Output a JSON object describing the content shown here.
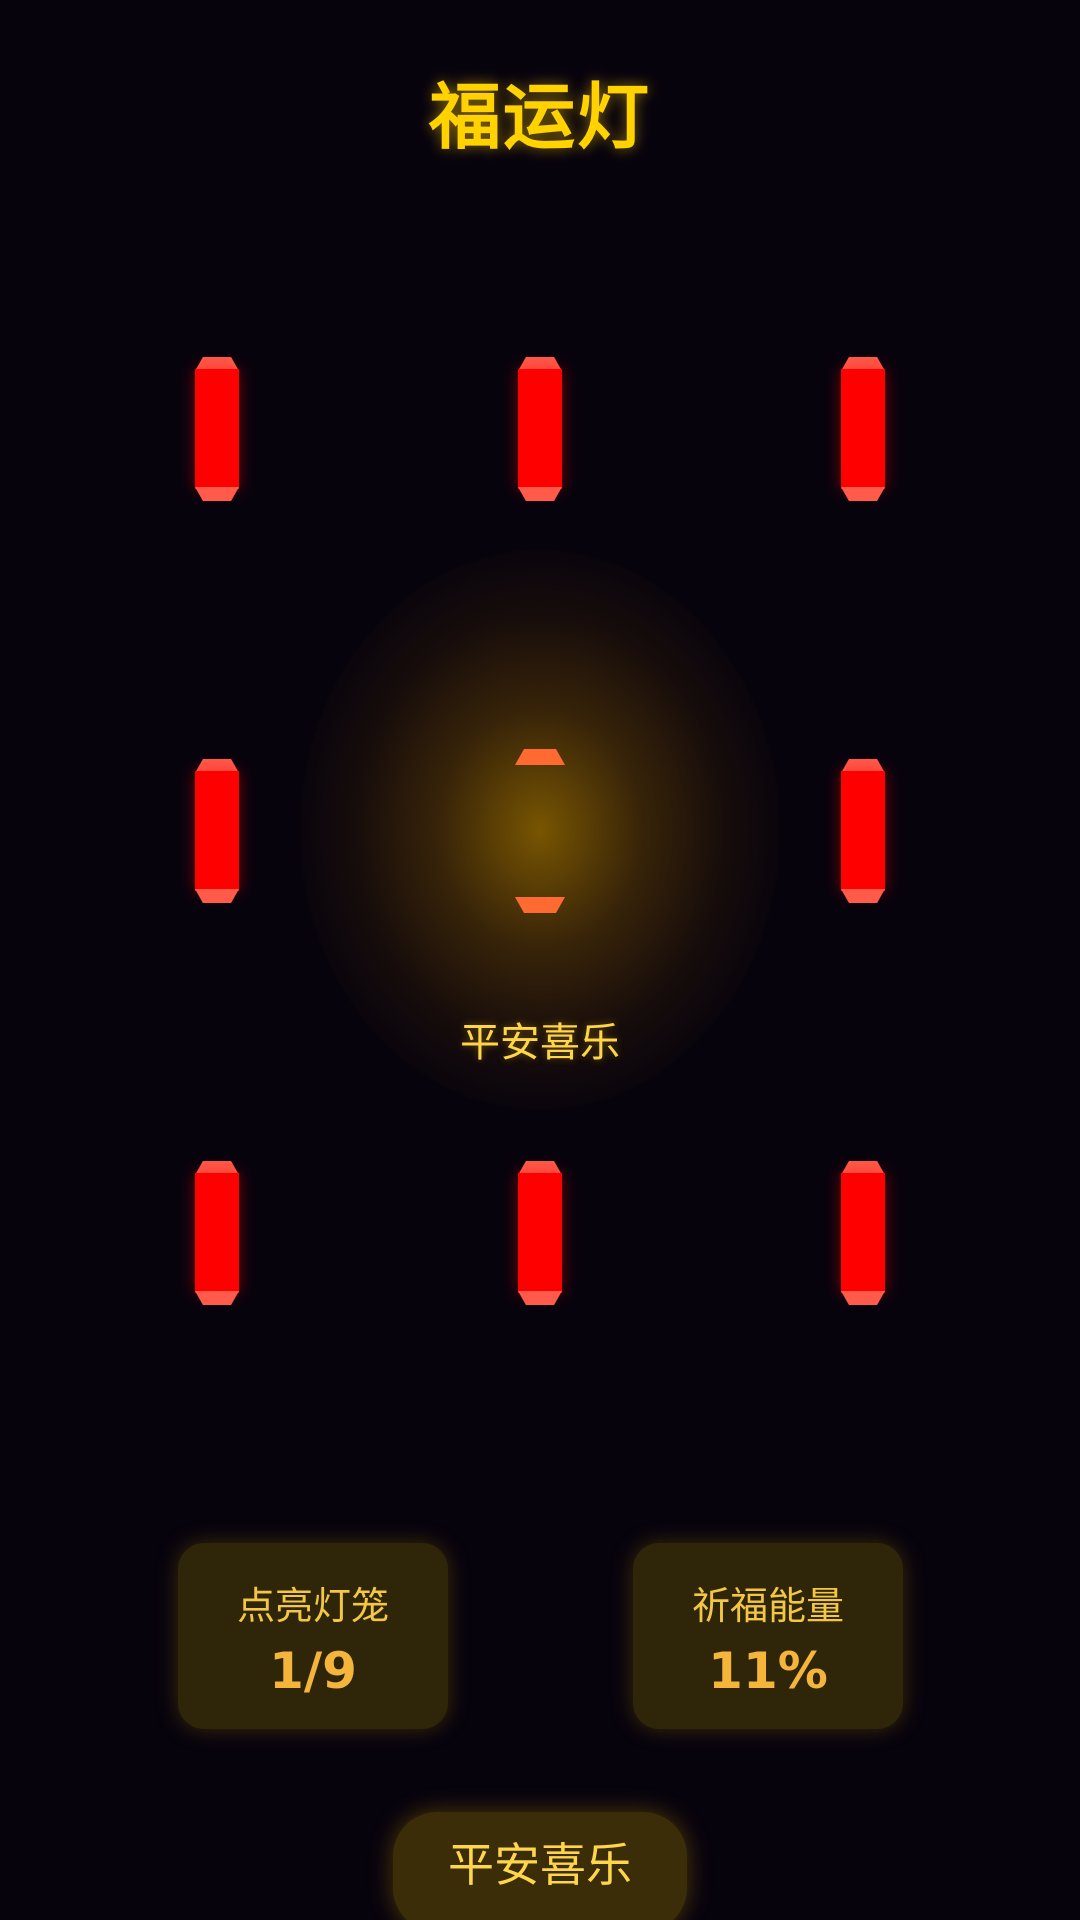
{
  "header": {
    "title": "福运灯"
  },
  "lanterns": {
    "total": 9,
    "lit_index": 4,
    "body_color": "#ff0000",
    "cap_color": "#ff5a4a",
    "lit_cap_color": "#ff6a30"
  },
  "blessing": {
    "text": "平安喜乐"
  },
  "stats": {
    "lit_label": "点亮灯笼",
    "lit_value": "1/9",
    "energy_label": "祈福能量",
    "energy_value": "11%"
  },
  "action": {
    "label": "平安喜乐"
  },
  "colors": {
    "background": "#07030d",
    "accent": "#ffd200",
    "panel": "#2f2508"
  }
}
